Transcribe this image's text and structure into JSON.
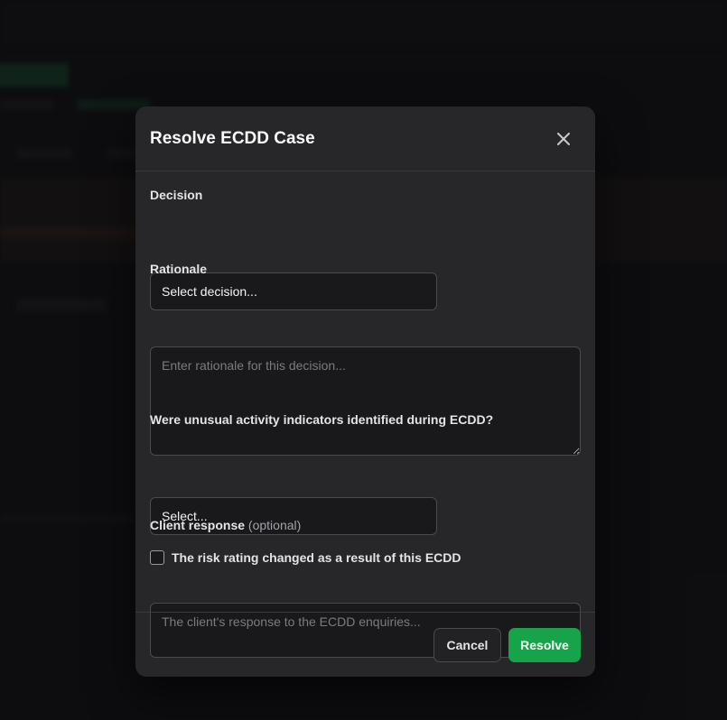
{
  "modal": {
    "title": "Resolve ECDD Case",
    "close_icon": "close-icon",
    "decision": {
      "label": "Decision",
      "value": "Select decision..."
    },
    "rationale": {
      "label": "Rationale",
      "placeholder": "Enter rationale for this decision..."
    },
    "unusual_activity": {
      "label": "Were unusual activity indicators identified during ECDD?",
      "value": "Select..."
    },
    "risk_rating_checkbox": {
      "label": "The risk rating changed as a result of this ECDD",
      "checked": false
    },
    "client_response": {
      "label": "Client response",
      "optional": "(optional)",
      "placeholder": "The client's response to the ECDD enquiries..."
    },
    "buttons": {
      "cancel": "Cancel",
      "resolve": "Resolve"
    }
  },
  "colors": {
    "accent": "#16a34a",
    "modal_bg": "#27272a",
    "input_bg": "#19191b"
  }
}
